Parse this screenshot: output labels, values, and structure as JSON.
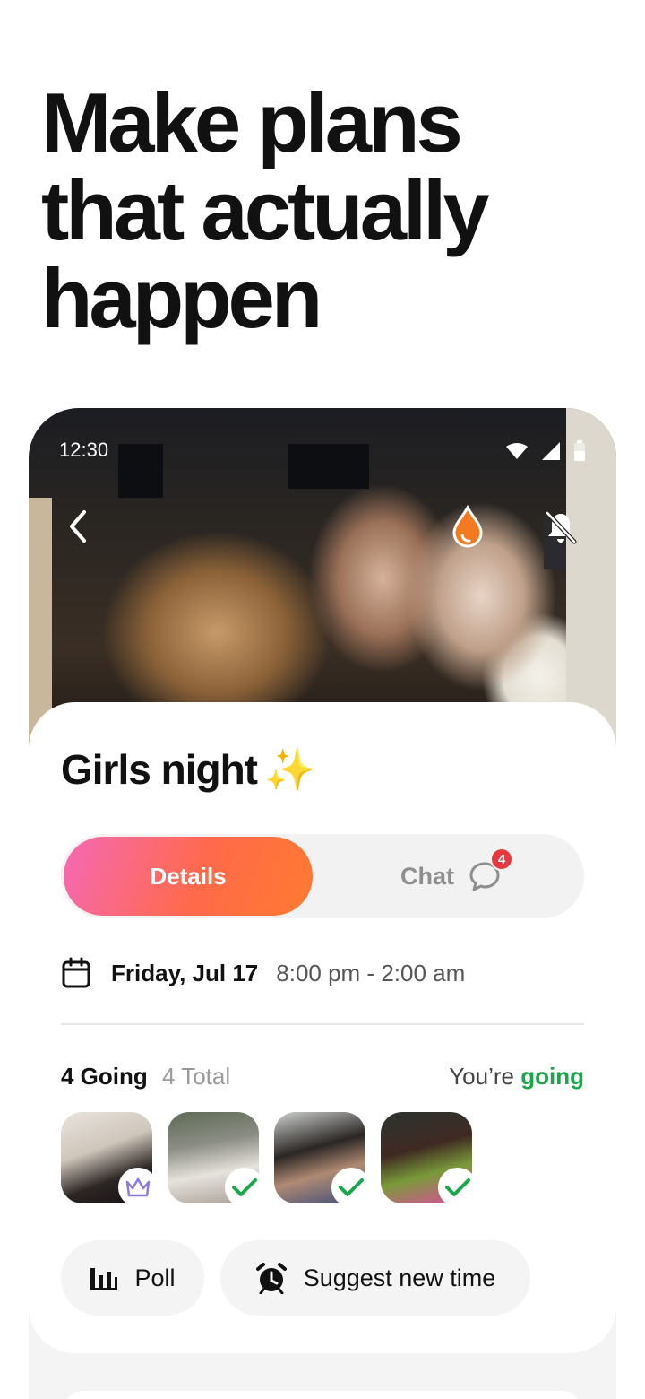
{
  "headline": {
    "line1": "Make plans",
    "line2": "that actually",
    "line3": "happen"
  },
  "status_bar": {
    "time": "12:30",
    "icons": [
      "wifi-icon",
      "signal-icon",
      "battery-icon"
    ]
  },
  "header_icons": [
    "back-icon",
    "drop-icon",
    "bell-off-icon"
  ],
  "event": {
    "title": "Girls night",
    "emoji": "✨",
    "tabs": {
      "details": "Details",
      "chat": "Chat",
      "chat_badge": "4"
    },
    "date": "Friday, Jul 17",
    "time_range": "8:00 pm - 2:00 am",
    "going_count": "4 Going",
    "total_count": "4 Total",
    "your_status_prefix": "You’re",
    "your_status": "going",
    "attendees": [
      {
        "name": "attendee-1",
        "role": "host",
        "mark": "crown-icon"
      },
      {
        "name": "attendee-2",
        "role": "going",
        "mark": "check-icon"
      },
      {
        "name": "attendee-3",
        "role": "going",
        "mark": "check-icon"
      },
      {
        "name": "attendee-4",
        "role": "going",
        "mark": "check-icon"
      }
    ],
    "actions": {
      "poll": "Poll",
      "suggest": "Suggest new time"
    }
  },
  "colors": {
    "accent_pink": "#f569b5",
    "accent_orange": "#ff6a4a",
    "going_green": "#1aa64a",
    "badge_red": "#e8383d",
    "crown_purple": "#8f7ae0"
  }
}
